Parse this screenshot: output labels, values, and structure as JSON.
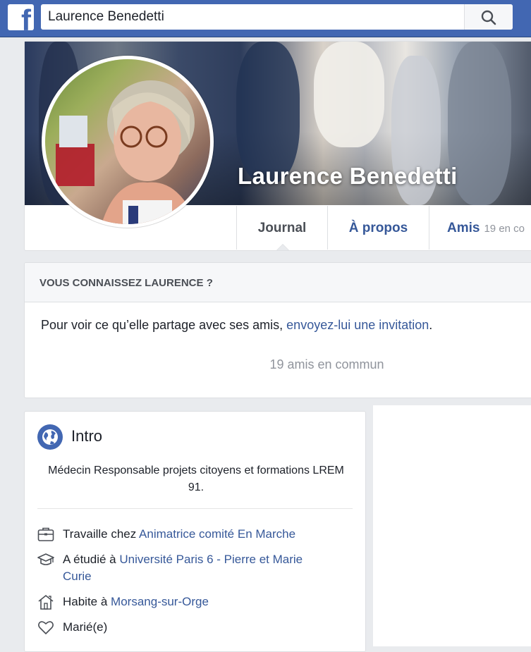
{
  "topbar": {
    "logo_letter": "f",
    "search_value": "Laurence Benedetti"
  },
  "profile": {
    "name": "Laurence Benedetti",
    "tabs": [
      {
        "label": "Journal"
      },
      {
        "label": "À propos"
      },
      {
        "label": "Amis",
        "count": "19 en co"
      }
    ]
  },
  "know": {
    "title": "VOUS CONNAISSEZ LAURENCE ?",
    "text_before": "Pour voir ce qu’elle partage avec ses amis, ",
    "link": "envoyez-lui une invitation",
    "text_after": ".",
    "mutual": "19 amis en commun"
  },
  "intro": {
    "title": "Intro",
    "bio": "Médecin Responsable projets citoyens et formations LREM 91.",
    "work_prefix": "Travaille chez ",
    "work_link": "Animatrice comité En Marche",
    "study_prefix": "A étudié à ",
    "study_link": "Université Paris 6 - Pierre et Marie Curie",
    "lives_prefix": "Habite à ",
    "lives_link": "Morsang-sur-Orge",
    "relationship": "Marié(e)"
  },
  "colors": {
    "brand": "#4267b2",
    "link": "#365899",
    "muted": "#90949c"
  }
}
